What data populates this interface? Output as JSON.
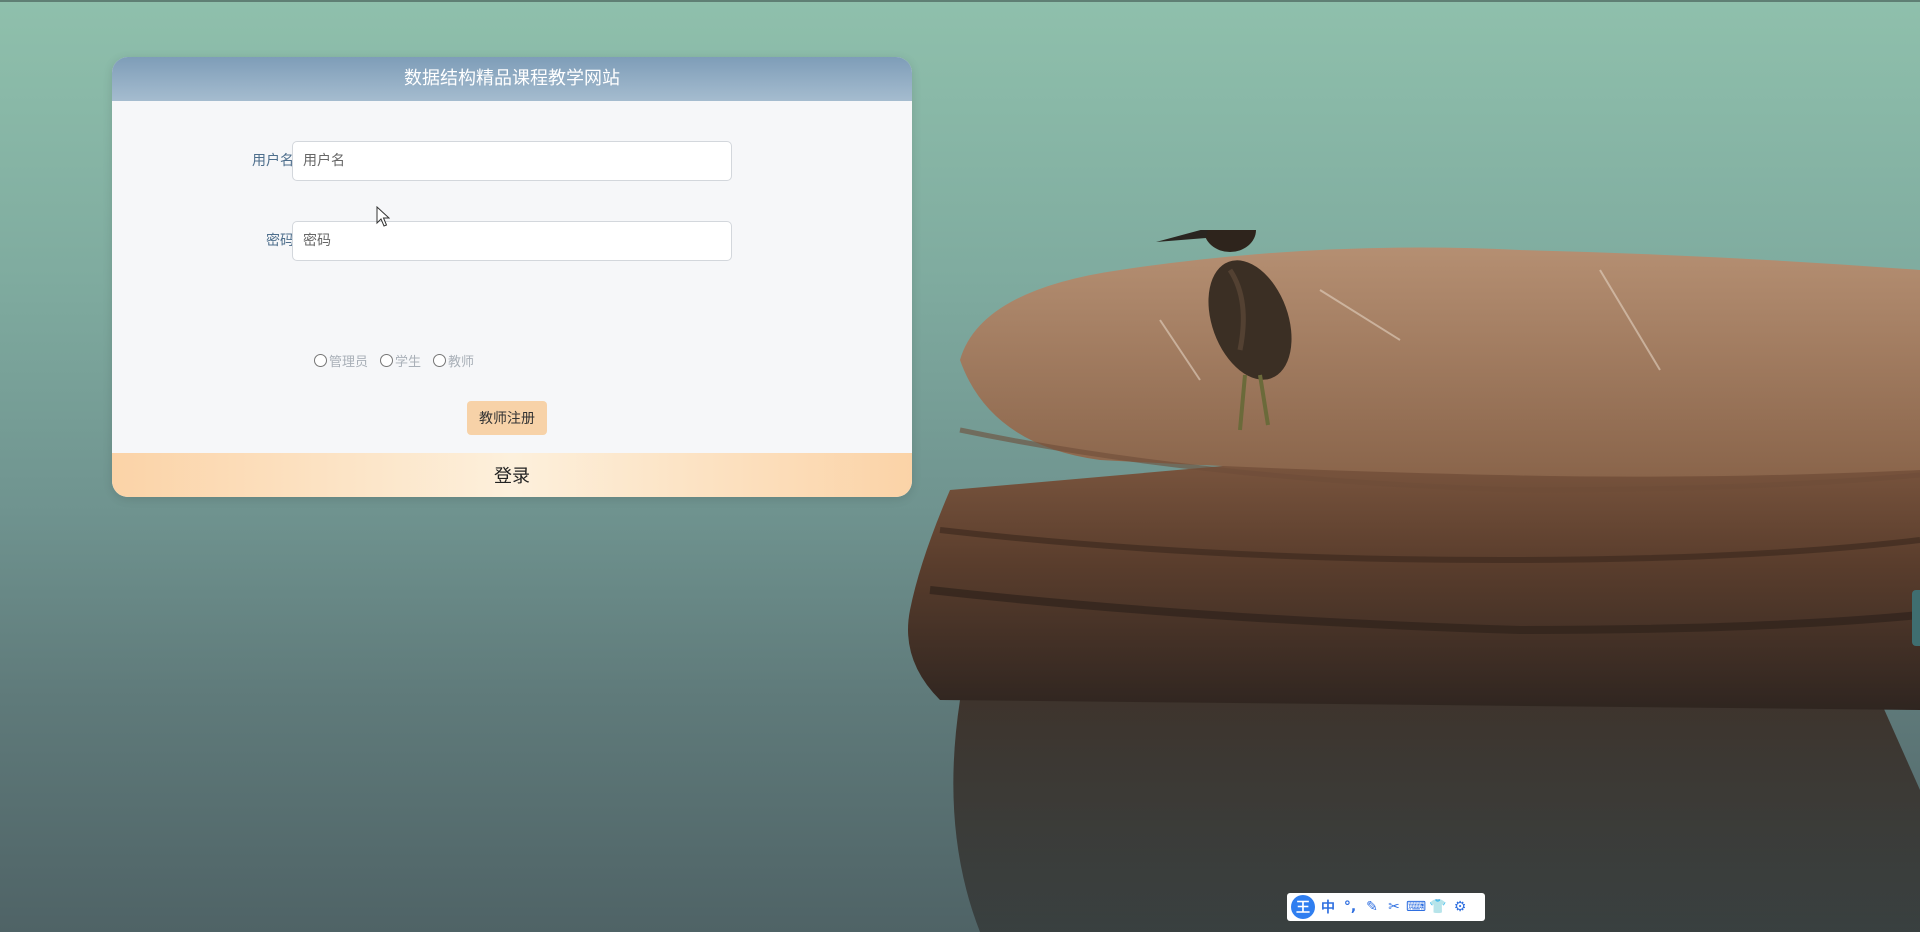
{
  "site": {
    "title": "数据结构精品课程教学网站"
  },
  "login_form": {
    "username_label": "用户名",
    "username_placeholder": "用户名",
    "username_value": "",
    "password_label": "密码",
    "password_placeholder": "密码",
    "password_value": "",
    "roles": [
      {
        "label": "管理员",
        "checked": false
      },
      {
        "label": "学生",
        "checked": false
      },
      {
        "label": "教师",
        "checked": false
      }
    ],
    "register_label": "教师注册",
    "login_label": "登录"
  },
  "ime_toolbar": {
    "logo": "王",
    "items": [
      {
        "label": "中",
        "icon": "chinese-mode-icon"
      },
      {
        "label": "°,",
        "icon": "punctuation-icon"
      },
      {
        "label": "✎",
        "icon": "handwriting-icon"
      },
      {
        "label": "✂",
        "icon": "screenshot-icon"
      },
      {
        "label": "⌨",
        "icon": "keyboard-icon"
      },
      {
        "label": "👕",
        "icon": "skin-icon"
      },
      {
        "label": "⚙",
        "icon": "settings-icon"
      }
    ]
  },
  "colors": {
    "header": "#8fa9c1",
    "label": "#4d6e8c",
    "login_button": "#fbd3a7",
    "register_button": "#f7d2a8",
    "ime_accent": "#2f7ef0"
  }
}
